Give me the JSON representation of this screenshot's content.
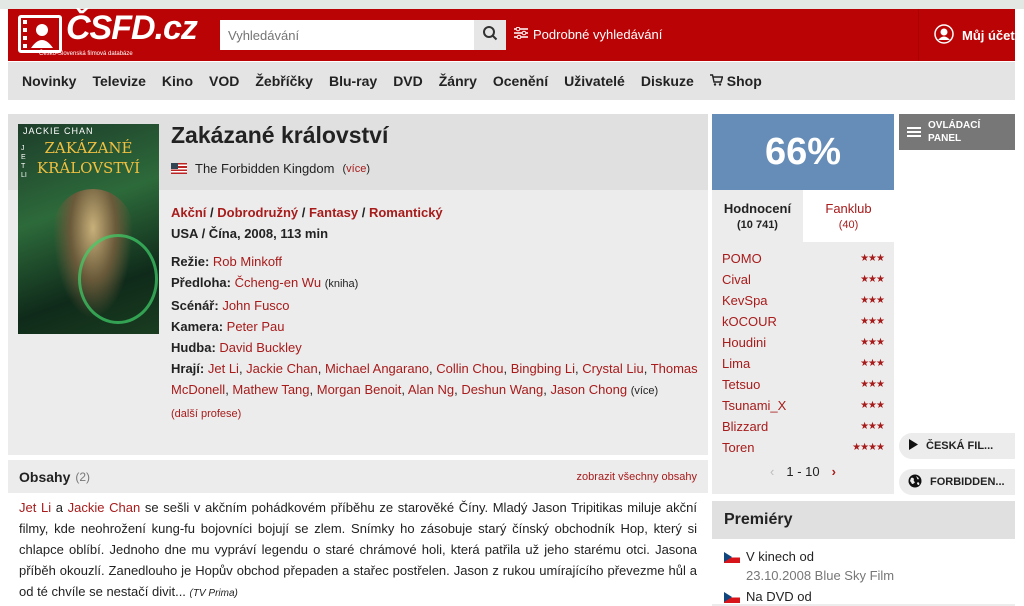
{
  "header": {
    "logo_text": "ČSFD.cz",
    "logo_sub": "Česko-Slovenská filmová databáze",
    "search_placeholder": "Vyhledávání",
    "advanced_search": "Podrobné vyhledávání",
    "account": "Můj účet"
  },
  "nav": {
    "items": [
      "Novinky",
      "Televize",
      "Kino",
      "VOD",
      "Žebříčky",
      "Blu-ray",
      "DVD",
      "Žánry",
      "Ocenění",
      "Uživatelé",
      "Diskuze",
      "Shop"
    ]
  },
  "film": {
    "poster_actor": "JACKIE CHAN",
    "poster_side": "JET LI",
    "poster_title_1": "ZAKÁZANÉ",
    "poster_title_2": "KRÁLOVSTVÍ",
    "title": "Zakázané království",
    "original_title": "The Forbidden Kingdom",
    "more": "více",
    "genres": [
      "Akční",
      "Dobrodružný",
      "Fantasy",
      "Romantický"
    ],
    "origin": "USA / Čína, 2008, 113 min",
    "director_label": "Režie:",
    "director": "Rob Minkoff",
    "source_label": "Předloha:",
    "source": "Čcheng-en Wu",
    "source_note": "(kniha)",
    "writer_label": "Scénář:",
    "writer": "John Fusco",
    "camera_label": "Kamera:",
    "camera": "Peter Pau",
    "music_label": "Hudba:",
    "music": "David Buckley",
    "cast_label": "Hrají:",
    "cast": [
      "Jet Li",
      "Jackie Chan",
      "Michael Angarano",
      "Collin Chou",
      "Bingbing Li",
      "Crystal Liu",
      "Thomas McDonell",
      "Mathew Tang",
      "Morgan Benoit",
      "Alan Ng",
      "Deshun Wang",
      "Jason Chong"
    ],
    "cast_more": "(více)",
    "more_professions": "(další profese)"
  },
  "plot": {
    "title": "Obsahy",
    "count": "(2)",
    "show_all": "zobrazit všechny obsahy",
    "actor1": "Jet Li",
    "and": "a",
    "actor2": "Jackie Chan",
    "text": "se sešli v akčním pohádkovém příběhu ze starověké Číny. Mladý Jason Tripitikas miluje akční filmy, kde neohrožení kung-fu bojovníci bojují se zlem. Snímky ho zásobuje starý čínský obchodník Hop, který si chlapce oblíbí. Jednoho dne mu vypráví legendu o staré chrámové holi, která patřila už jeho starému otci. Jasona příběh okouzlí. Zanedlouho je Hopův obchod přepaden a stařec postřelen. Jason z rukou umírajícího převezme hůl a od té chvíle se nestačí divit...",
    "source": "(TV Prima)"
  },
  "rating": {
    "percent": "66%",
    "tab_ratings": "Hodnocení",
    "tab_ratings_count": "(10 741)",
    "tab_fanclub": "Fanklub",
    "tab_fanclub_count": "(40)",
    "users": [
      {
        "name": "POMO",
        "stars": "★★★"
      },
      {
        "name": "Cival",
        "stars": "★★★"
      },
      {
        "name": "KevSpa",
        "stars": "★★★"
      },
      {
        "name": "kOCOUR",
        "stars": "★★★"
      },
      {
        "name": "Houdini",
        "stars": "★★★"
      },
      {
        "name": "Lima",
        "stars": "★★★"
      },
      {
        "name": "Tetsuo",
        "stars": "★★★"
      },
      {
        "name": "Tsunami_X",
        "stars": "★★★"
      },
      {
        "name": "Blizzard",
        "stars": "★★★"
      },
      {
        "name": "Toren",
        "stars": "★★★★"
      }
    ],
    "pager": "1 - 10"
  },
  "side": {
    "control_panel": "OVLÁDACÍ PANEL",
    "btn1": "ČESKÁ FIL...",
    "btn2": "FORBIDDEN..."
  },
  "premiery": {
    "title": "Premiéry",
    "row1_label": "V kinech od",
    "row1_sub": "23.10.2008 Blue Sky Film",
    "row2_label": "Na DVD od"
  },
  "colors": {
    "brand_red": "#ba0305",
    "link_red": "#a81b1b",
    "rating_blue": "#658db7"
  }
}
